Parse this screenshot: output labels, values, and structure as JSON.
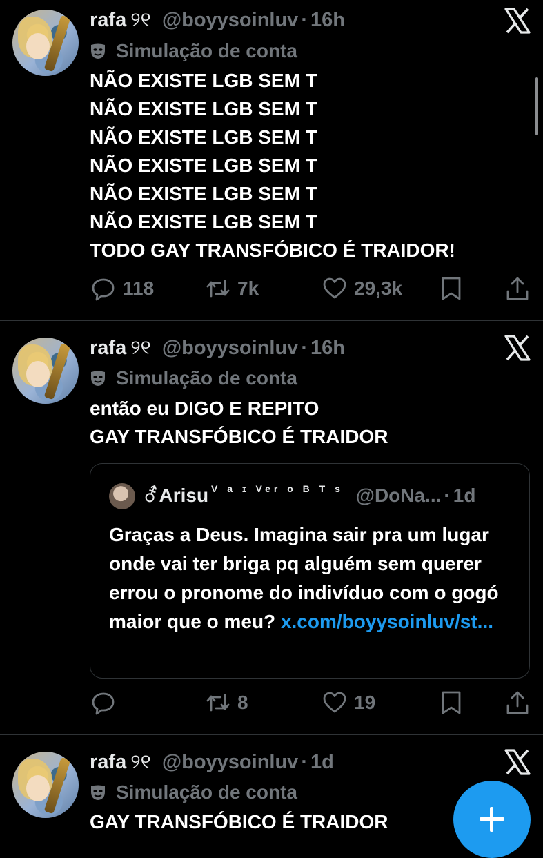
{
  "tweets": [
    {
      "name": "rafa",
      "glyph": "୨୧",
      "handle": "@boyysoinluv",
      "separator": "·",
      "time": "16h",
      "label": "Simulação de conta",
      "text": "NÃO EXISTE LGB SEM T\nNÃO EXISTE LGB SEM T\nNÃO EXISTE LGB SEM T\nNÃO EXISTE LGB SEM T\nNÃO EXISTE LGB SEM T\nNÃO EXISTE LGB SEM T\nTODO GAY TRANSFÓBICO É TRAIDOR!",
      "replies": "118",
      "reposts": "7k",
      "likes": "29,3k"
    },
    {
      "name": "rafa",
      "glyph": "୨୧",
      "handle": "@boyysoinluv",
      "separator": "·",
      "time": "16h",
      "label": "Simulação de conta",
      "text": "então eu DIGO E REPITO\nGAY TRANSFÓBICO É TRAIDOR",
      "replies": "",
      "reposts": "8",
      "likes": "19",
      "quote": {
        "name_prefix": "⚦",
        "name": "Arisu",
        "sup": "V a ɪ Ver ᴏ B T s",
        "handle": "@DoNa...",
        "separator": "·",
        "time": "1d",
        "text": "Graças a Deus. Imagina sair pra um lugar onde vai ter briga pq alguém sem querer errou o pronome do indivíduo com o gogó maior que o meu? ",
        "link": "x.com/boyysoinluv/st..."
      }
    },
    {
      "name": "rafa",
      "glyph": "୨୧",
      "handle": "@boyysoinluv",
      "separator": "·",
      "time": "1d",
      "label": "Simulação de conta",
      "text": "GAY TRANSFÓBICO É TRAIDOR"
    }
  ],
  "icons": {
    "x_logo": "x-logo-icon",
    "parody": "parody-mask-icon",
    "reply": "reply-icon",
    "repost": "repost-icon",
    "like": "heart-icon",
    "bookmark": "bookmark-icon",
    "share": "share-icon",
    "compose": "compose-plus-icon"
  },
  "colors": {
    "background": "#000000",
    "text": "#ffffff",
    "secondary": "#71767b",
    "accent": "#1d9bf0",
    "divider": "#2f3336"
  }
}
